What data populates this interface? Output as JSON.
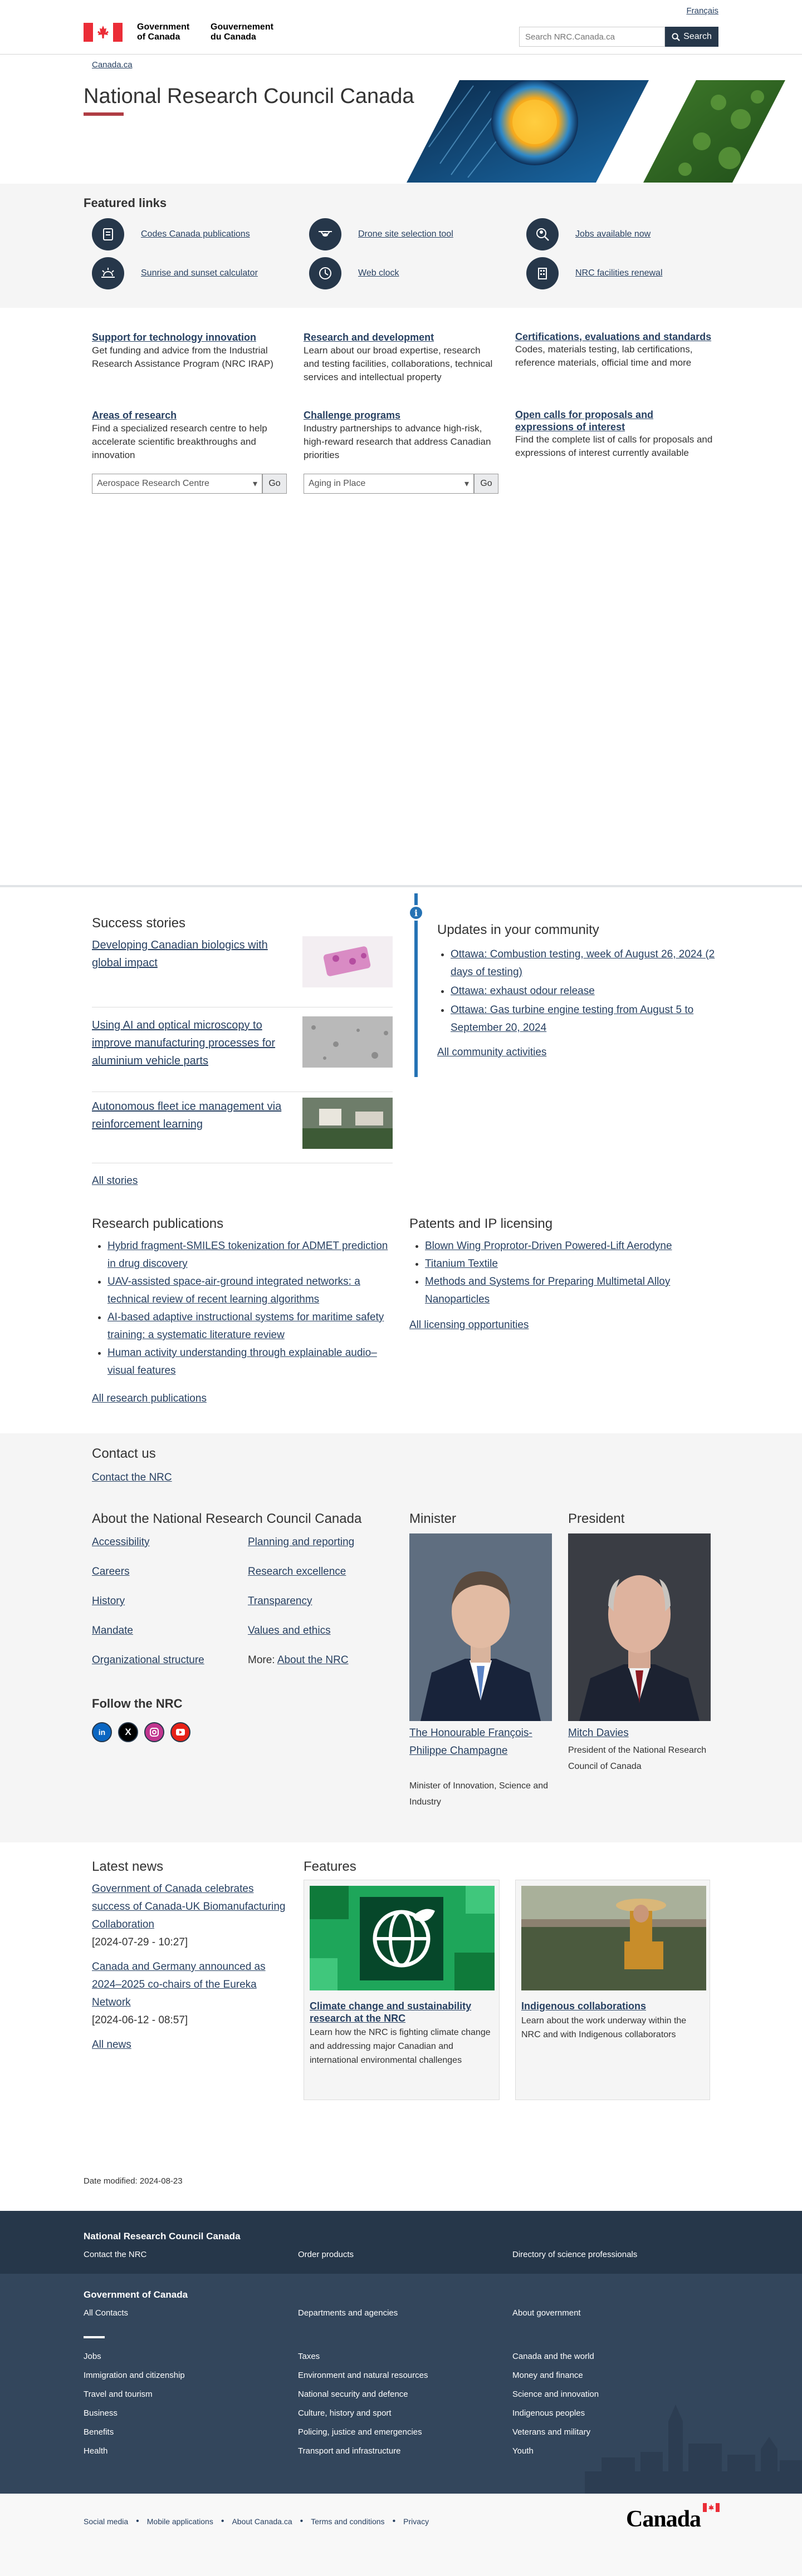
{
  "header": {
    "lang_toggle": "Français",
    "gov_en_1": "Government",
    "gov_en_2": "of Canada",
    "gov_fr_1": "Gouvernement",
    "gov_fr_2": "du Canada",
    "search_placeholder": "Search NRC.Canada.ca",
    "search_button": "Search",
    "breadcrumb": "Canada.ca"
  },
  "hero": {
    "title": "National Research Council Canada"
  },
  "featured": {
    "heading": "Featured links",
    "links": [
      {
        "label": "Codes Canada publications",
        "icon": "book-icon"
      },
      {
        "label": "Drone site selection tool",
        "icon": "drone-icon"
      },
      {
        "label": "Jobs available now",
        "icon": "person-search-icon"
      },
      {
        "label": "Sunrise and sunset calculator",
        "icon": "sunrise-icon"
      },
      {
        "label": "Web clock",
        "icon": "clock-icon"
      },
      {
        "label": "NRC facilities renewal",
        "icon": "building-icon"
      }
    ]
  },
  "services": [
    {
      "title": "Support for technology innovation",
      "desc": "Get funding and advice from the Industrial Research Assistance Program (NRC IRAP)"
    },
    {
      "title": "Research and development",
      "desc": "Learn about our broad expertise, research and testing facilities, collaborations, technical services and intellectual property"
    },
    {
      "title": "Certifications, evaluations and standards",
      "desc": "Codes, materials testing, lab certifications, reference materials, official time and more"
    },
    {
      "title": "Areas of research",
      "desc": "Find a specialized research centre to help accelerate scientific breakthroughs and innovation"
    },
    {
      "title": "Challenge programs",
      "desc": "Industry partnerships to advance high-risk, high-reward research that address Canadian priorities"
    },
    {
      "title": "Open calls for proposals and expressions of interest",
      "desc": "Find the complete list of calls for proposals and expressions of interest currently available"
    }
  ],
  "selects": {
    "research_centre": "Aerospace Research Centre",
    "challenge": "Aging in Place",
    "go": "Go"
  },
  "success": {
    "heading": "Success stories",
    "stories": [
      "Developing Canadian biologics with global impact",
      "Using AI and optical microscopy to improve manufacturing processes for aluminium vehicle parts",
      "Autonomous fleet ice management via reinforcement learning"
    ],
    "all": "All stories"
  },
  "updates": {
    "badge": "i",
    "heading": "Updates in your community",
    "items": [
      "Ottawa: Combustion testing, week of August 26, 2024 (2 days of testing)",
      "Ottawa: exhaust odour release",
      "Ottawa: Gas turbine engine testing from August 5 to September 20, 2024"
    ],
    "all": "All community activities"
  },
  "publications": {
    "heading": "Research publications",
    "items": [
      "Hybrid fragment-SMILES tokenization for ADMET prediction in drug discovery",
      "UAV-assisted space-air-ground integrated networks: a technical review of recent learning algorithms",
      "AI-based adaptive instructional systems for maritime safety training: a systematic literature review",
      "Human activity understanding through explainable audio–visual features"
    ],
    "all": "All research publications"
  },
  "patents": {
    "heading": "Patents and IP licensing",
    "items": [
      "Blown Wing Proprotor-Driven Powered-Lift Aerodyne",
      "Titanium Textile",
      "Methods and Systems for Preparing Multimetal Alloy Nanoparticles"
    ],
    "all": "All licensing opportunities"
  },
  "contact": {
    "heading": "Contact us",
    "link": "Contact the NRC"
  },
  "about": {
    "heading": "About the National Research Council Canada",
    "col1": [
      "Accessibility",
      "Careers",
      "History",
      "Mandate",
      "Organizational structure"
    ],
    "col2": [
      "Planning and reporting",
      "Research excellence",
      "Transparency",
      "Values and ethics"
    ],
    "more_prefix": "More:",
    "more_link": "About the NRC"
  },
  "follow": {
    "heading": "Follow the NRC"
  },
  "minister": {
    "heading": "Minister",
    "name": "The Honourable François-Philippe Champagne",
    "role": "Minister of Innovation, Science and Industry"
  },
  "president": {
    "heading": "President",
    "name": "Mitch Davies",
    "role": "President of the National Research Council of Canada"
  },
  "news": {
    "heading": "Latest news",
    "items": [
      {
        "title": "Government of Canada celebrates success of Canada-UK Biomanufacturing Collaboration",
        "date": "[2024-07-29 - 10:27]"
      },
      {
        "title": "Canada and Germany announced as 2024–2025 co-chairs of the Eureka Network",
        "date": "[2024-06-12 - 08:57]"
      }
    ],
    "all": "All news"
  },
  "features": {
    "heading": "Features",
    "cards": [
      {
        "title": "Climate change and sustainability research at the NRC",
        "desc": "Learn how the NRC is fighting climate change and addressing major Canadian and international environmental challenges"
      },
      {
        "title": "Indigenous collaborations",
        "desc": "Learn about the work underway within the NRC and with Indigenous collaborators"
      }
    ]
  },
  "date_modified": "Date modified: 2024-08-23",
  "footer": {
    "nrc_heading": "National Research Council Canada",
    "nrc_links": [
      "Contact the NRC",
      "Order products",
      "Directory of science professionals"
    ],
    "gc_heading": "Government of Canada",
    "gc_top": [
      "All Contacts",
      "Departments and agencies",
      "About government"
    ],
    "gc_col1": [
      "Jobs",
      "Immigration and citizenship",
      "Travel and tourism",
      "Business",
      "Benefits",
      "Health"
    ],
    "gc_col2": [
      "Taxes",
      "Environment and natural resources",
      "National security and defence",
      "Culture, history and sport",
      "Policing, justice and emergencies",
      "Transport and infrastructure"
    ],
    "gc_col3": [
      "Canada and the world",
      "Money and finance",
      "Science and innovation",
      "Indigenous peoples",
      "Veterans and military",
      "Youth"
    ],
    "bottom": [
      "Social media",
      "Mobile applications",
      "About Canada.ca",
      "Terms and conditions",
      "Privacy"
    ],
    "wordmark": "Canada"
  },
  "colors": {
    "brand_navy": "#26374a",
    "link": "#284162",
    "accent_red": "#af3c43",
    "info_blue": "#2572b4"
  }
}
